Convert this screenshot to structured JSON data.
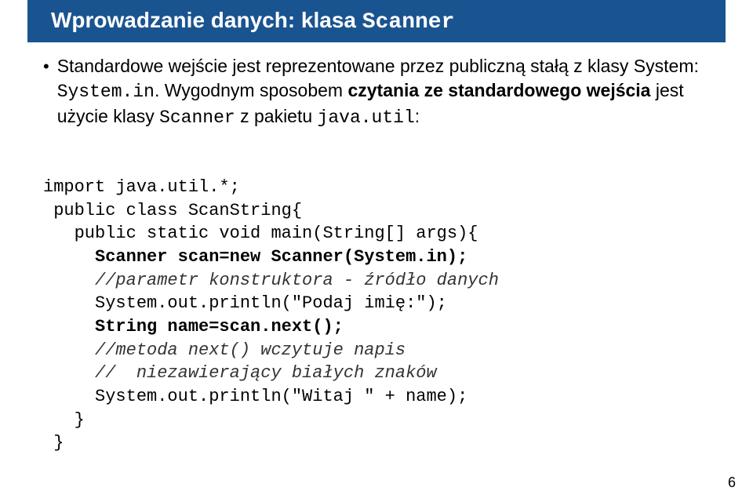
{
  "title": {
    "text_part1": "Wprowadzanie danych: klasa ",
    "mono_part": "Scanner"
  },
  "paragraph": {
    "bullet": "•",
    "t1": "Standardowe wejście jest reprezentowane przez publiczną stałą z klasy System: ",
    "mono1": "System.in",
    "t2": ". Wygodnym sposobem ",
    "bold1": "czytania ze standardowego wejścia",
    "t3": " jest użycie klasy ",
    "mono2": "Scanner",
    "t4": " z pakietu ",
    "mono3": "java.util",
    "t5": ":"
  },
  "code": {
    "l1": "import java.util.*;",
    "l2": " public class ScanString{",
    "l3": "   public static void main(String[] args){",
    "l4": "     Scanner scan=new Scanner(System.in);",
    "c1": "     //parametr konstruktora - źródło danych",
    "l5": "     System.out.println(\"Podaj imię:\");",
    "l6": "     String name=scan.next();",
    "c2": "     //metoda next() wczytuje napis",
    "c3": "     //  niezawierający białych znaków",
    "l7": "     System.out.println(\"Witaj \" + name);",
    "l8": "   }",
    "l9": " }"
  },
  "pageNumber": "6"
}
